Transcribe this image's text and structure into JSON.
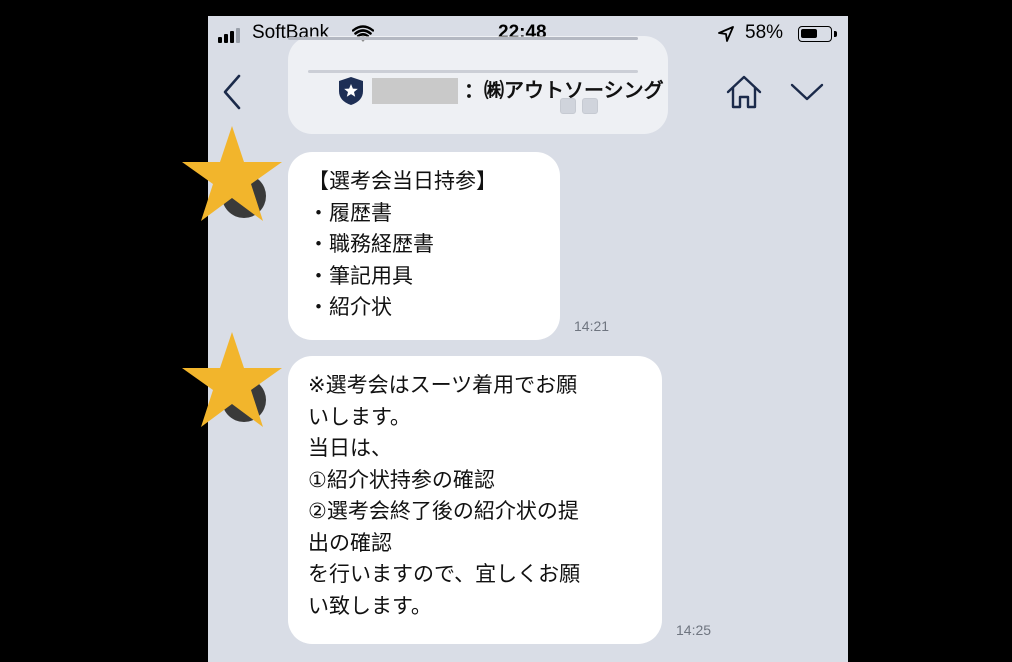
{
  "status_bar": {
    "carrier": "SoftBank",
    "time": "22:48",
    "battery_percent_label": "58%",
    "battery_level": 0.58
  },
  "header": {
    "title": "：㈱アウトソーシング",
    "back_icon": "chevron-left-icon",
    "home_icon": "home-icon",
    "menu_icon": "chevron-down-icon"
  },
  "messages": [
    {
      "text": "【選考会当日持参】\n・履歴書\n・職務経歴書\n・筆記用具\n・紹介状",
      "time": "14:21"
    },
    {
      "text": "※選考会はスーツ着用でお願\nいします。\n当日は、\n①紹介状持参の確認\n②選考会終了後の紹介状の提\n出の確認\nを行いますので、宜しくお願\nい致します。",
      "time": "14:25"
    }
  ],
  "colors": {
    "chat_background": "#d9dde6",
    "bubble": "#ffffff",
    "star": "#f2b52c"
  }
}
